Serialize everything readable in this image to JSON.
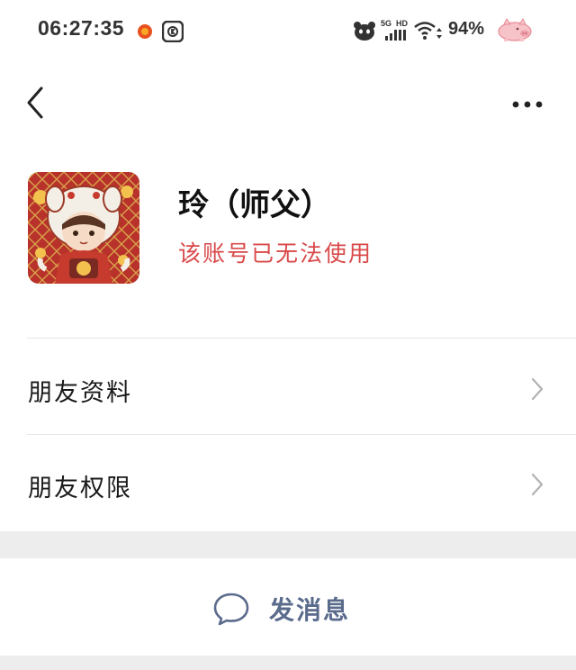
{
  "status_bar": {
    "time": "06:27:35",
    "network_label_top": "5G",
    "network_label_hd": "HD",
    "battery": "94%",
    "icons": [
      "notification-orange-icon",
      "app-k-icon",
      "panda-icon",
      "signal-icon",
      "wifi-icon",
      "pig-icon"
    ]
  },
  "nav": {
    "back_icon": "chevron-left-icon",
    "more_icon": "more-dots-icon"
  },
  "profile": {
    "name": "玲（师父）",
    "status": "该账号已无法使用",
    "avatar_icon": "lion-dance-avatar"
  },
  "menu": {
    "items": [
      {
        "label": "朋友资料",
        "icon": "chevron-right-icon"
      },
      {
        "label": "朋友权限",
        "icon": "chevron-right-icon"
      }
    ]
  },
  "actions": {
    "send_message_label": "发消息",
    "send_message_icon": "chat-bubble-icon"
  },
  "colors": {
    "status_red": "#d9494a",
    "action_blue": "#5b6b8c",
    "band_gray": "#ededed"
  }
}
